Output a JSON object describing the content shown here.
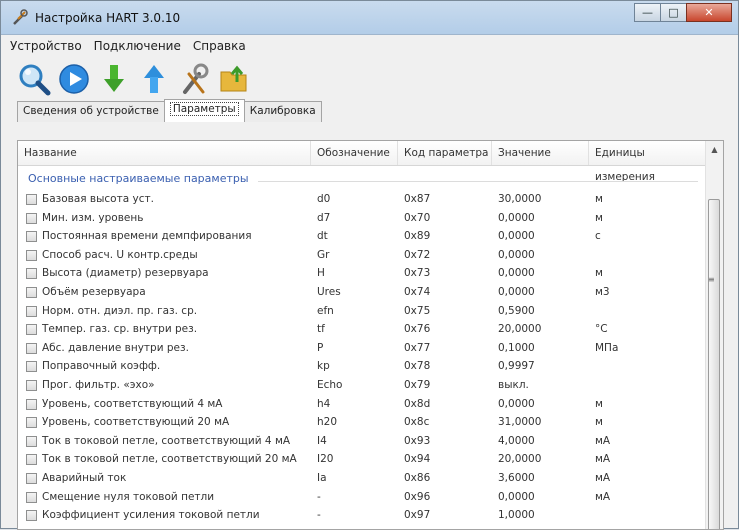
{
  "window": {
    "title": "Настройка HART 3.0.10",
    "minimize": "—",
    "maximize": "□",
    "close": "✕"
  },
  "menu": [
    "Устройство",
    "Подключение",
    "Справка"
  ],
  "toolbar": [
    {
      "icon": "search-icon"
    },
    {
      "icon": "play-icon"
    },
    {
      "icon": "download-arrow-icon"
    },
    {
      "icon": "upload-arrow-icon"
    },
    {
      "icon": "tools-icon"
    },
    {
      "icon": "folder-open-icon"
    }
  ],
  "tabs": [
    "Сведения об устройстве",
    "Параметры",
    "Калибровка"
  ],
  "active_tab": 1,
  "table": {
    "columns": [
      "Название",
      "Обозначение",
      "Код параметра",
      "Значение",
      "Единицы измерения"
    ],
    "group_title": "Основные настраиваемые параметры",
    "rows": [
      {
        "name": "Базовая высота уст.",
        "sym": "d0",
        "code": "0x87",
        "value": "30,0000",
        "unit": "м"
      },
      {
        "name": "Мин. изм. уровень",
        "sym": "d7",
        "code": "0x70",
        "value": "0,0000",
        "unit": "м"
      },
      {
        "name": "Постоянная времени демпфирования",
        "sym": "dt",
        "code": "0x89",
        "value": "0,0000",
        "unit": "с"
      },
      {
        "name": "Способ расч. U контр.среды",
        "sym": "Gr",
        "code": "0x72",
        "value": "0,0000",
        "unit": ""
      },
      {
        "name": "Высота (диаметр) резервуара",
        "sym": "H",
        "code": "0x73",
        "value": "0,0000",
        "unit": "м"
      },
      {
        "name": "Объём резервуара",
        "sym": "Ures",
        "code": "0x74",
        "value": "0,0000",
        "unit": "м3"
      },
      {
        "name": "Норм. отн. диэл. пр. газ. ср.",
        "sym": "efn",
        "code": "0x75",
        "value": "0,5900",
        "unit": ""
      },
      {
        "name": "Темпер. газ. ср. внутри рез.",
        "sym": "tf",
        "code": "0x76",
        "value": "20,0000",
        "unit": "°C"
      },
      {
        "name": "Абс. давление внутри рез.",
        "sym": "P",
        "code": "0x77",
        "value": "0,1000",
        "unit": "МПа"
      },
      {
        "name": "Поправочный коэфф.",
        "sym": "kp",
        "code": "0x78",
        "value": "0,9997",
        "unit": ""
      },
      {
        "name": "Прог. фильтр. «эхо»",
        "sym": "Echo",
        "code": "0x79",
        "value": "выкл.",
        "unit": ""
      },
      {
        "name": "Уровень, соответствующий 4 мА",
        "sym": "h4",
        "code": "0x8d",
        "value": "0,0000",
        "unit": "м"
      },
      {
        "name": "Уровень, соответствующий 20 мА",
        "sym": "h20",
        "code": "0x8c",
        "value": "31,0000",
        "unit": "м"
      },
      {
        "name": "Ток в токовой петле, соответствующий 4 мА",
        "sym": "I4",
        "code": "0x93",
        "value": "4,0000",
        "unit": "мА"
      },
      {
        "name": "Ток в токовой петле, соответствующий 20 мА",
        "sym": "I20",
        "code": "0x94",
        "value": "20,0000",
        "unit": "мА"
      },
      {
        "name": "Аварийный ток",
        "sym": "Ia",
        "code": "0x86",
        "value": "3,6000",
        "unit": "мА"
      },
      {
        "name": "Смещение нуля токовой петли",
        "sym": "-",
        "code": "0x96",
        "value": "0,0000",
        "unit": "мА"
      },
      {
        "name": "Коэффициент усиления токовой петли",
        "sym": "-",
        "code": "0x97",
        "value": "1,0000",
        "unit": ""
      }
    ]
  }
}
